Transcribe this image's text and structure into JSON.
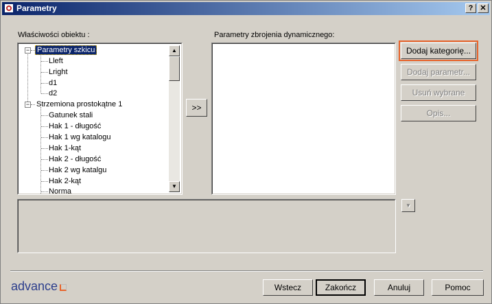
{
  "window": {
    "title": "Parametry",
    "help_label": "?",
    "close_label": "✕"
  },
  "left_panel": {
    "label": "Właściwości obiektu :"
  },
  "tree": {
    "groups": [
      {
        "label": "Parametry szkicu",
        "expanded": true,
        "selected": true,
        "children": [
          "Lleft",
          "Lright",
          "d1",
          "d2"
        ]
      },
      {
        "label": "Strzemiona prostokątne 1",
        "expanded": true,
        "children": [
          "Gatunek stali",
          "Hak 1 - długość",
          "Hak 1 wg katalogu",
          "Hak 1-kąt",
          "Hak 2 - długość",
          "Hak 2 wg katalgu",
          "Hak 2-kąt",
          "Norma"
        ]
      }
    ],
    "scroll_up_icon": "arrow-up-icon",
    "scroll_down_icon": "arrow-down-icon"
  },
  "transfer_button": {
    "label": ">>"
  },
  "right_panel": {
    "label": "Parametry zbrojenia dynamicznego:"
  },
  "side_buttons": {
    "add_category": "Dodaj kategorię...",
    "add_parameter": "Dodaj parametr...",
    "remove_selected": "Usuń wybrane",
    "description": "Opis..."
  },
  "footer": {
    "logo_text": "advance",
    "back": "Wstecz",
    "finish": "Zakończ",
    "cancel": "Anuluj",
    "help": "Pomoc"
  },
  "colors": {
    "accent_focus": "#e8632a",
    "title_bar": "#0a246a",
    "face": "#d4d0c8"
  }
}
